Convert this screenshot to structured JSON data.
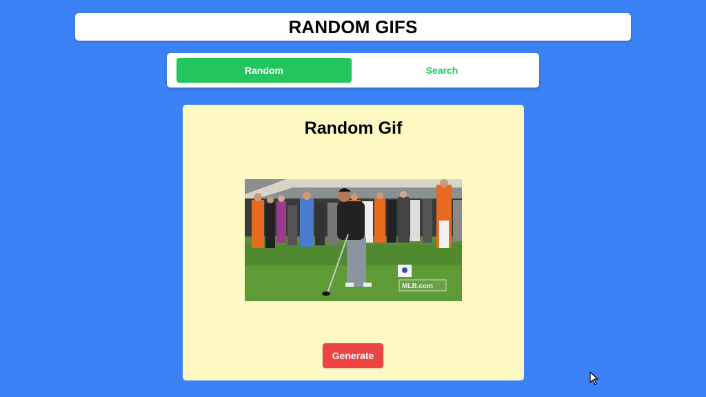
{
  "header": {
    "title": "RANDOM GIFS"
  },
  "tabs": [
    {
      "label": "Random",
      "active": true
    },
    {
      "label": "Search",
      "active": false
    }
  ],
  "card": {
    "title": "Random Gif",
    "gif_watermark": "MLB.com",
    "generate_label": "Generate"
  },
  "colors": {
    "background": "#3b82f6",
    "active_tab": "#22c55e",
    "card": "#fef9c3",
    "generate_button": "#ef4444"
  }
}
